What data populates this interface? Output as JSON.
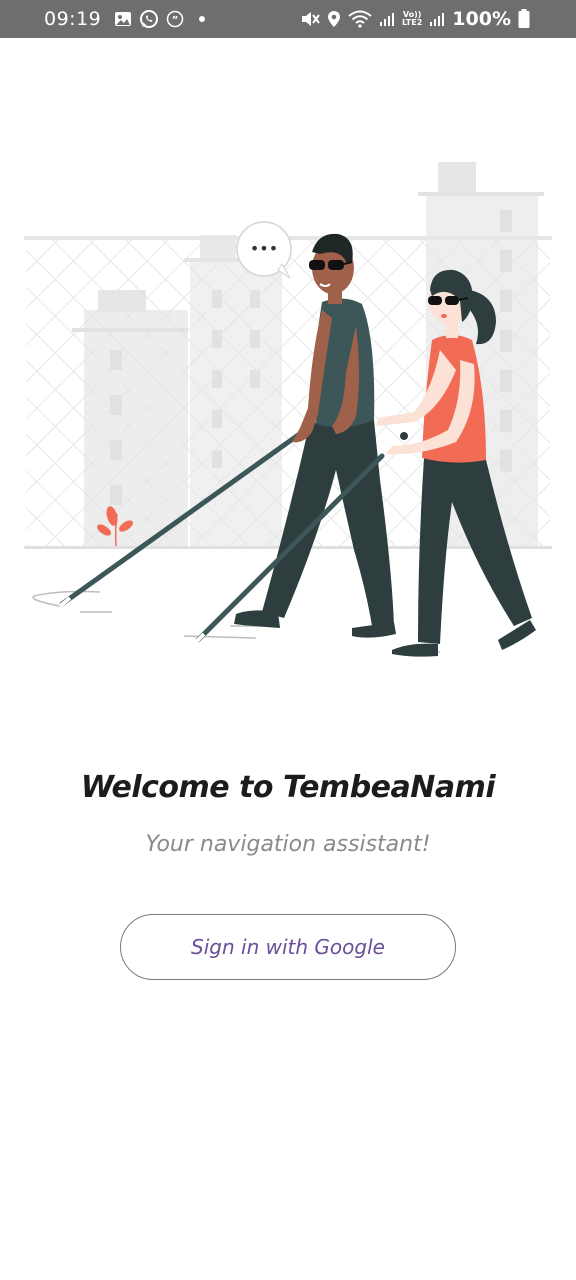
{
  "status_bar": {
    "time": "09:19",
    "battery_percent": "100%",
    "network_label": "LTE2",
    "icons_left": [
      "gallery-icon",
      "whatsapp-icon",
      "quote-notification-icon",
      "dot-icon"
    ],
    "icons_right": [
      "mute-icon",
      "location-icon",
      "wifi-icon",
      "signal-icon",
      "volte-lte-icon",
      "signal-icon",
      "battery-icon"
    ]
  },
  "illustration": {
    "accent_color": "#f26b55",
    "figure_color": "#2e3e3f",
    "shirt_man_color": "#3d5657",
    "shirt_woman_color": "#f26b55",
    "skin_man_color": "#a0614a",
    "skin_woman_color": "#fbe1d6",
    "speech_bubble_text": "•••"
  },
  "welcome": {
    "title": "Welcome to TembeaNami",
    "subtitle": "Your navigation assistant!"
  },
  "sign_in": {
    "label": "Sign in with Google",
    "text_color": "#6a4f9a"
  }
}
